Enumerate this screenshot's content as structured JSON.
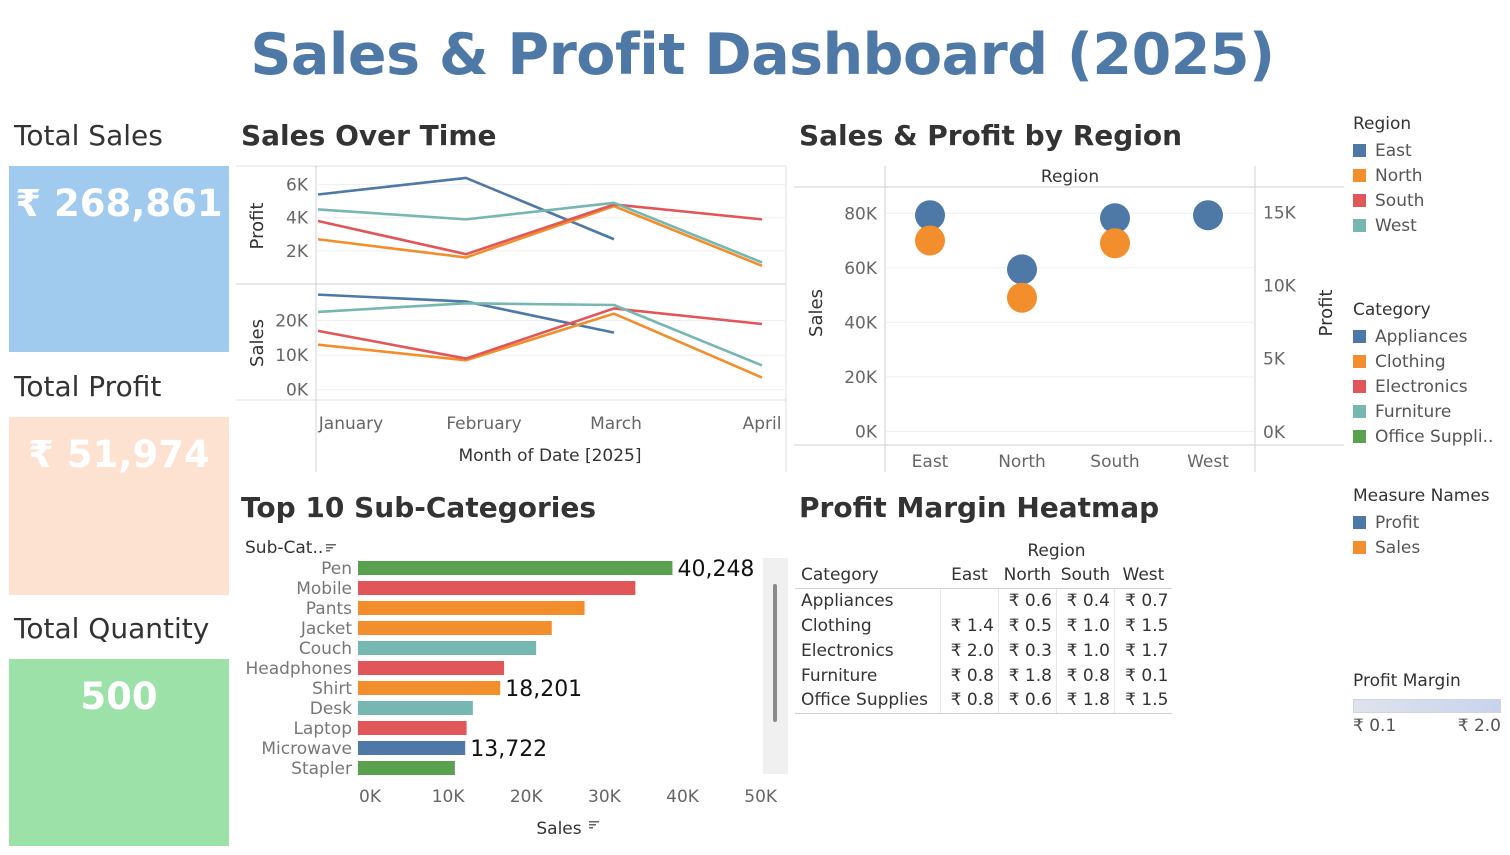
{
  "title": "Sales & Profit Dashboard (2025)",
  "kpis": {
    "total_sales": {
      "label": "Total Sales",
      "value": "₹ 268,861",
      "color": "#a0cbee"
    },
    "total_profit": {
      "label": "Total Profit",
      "value": "₹ 51,974",
      "color": "#fde2d2"
    },
    "total_quantity": {
      "label": "Total Quantity",
      "value": "500",
      "color": "#9ce2a8"
    }
  },
  "sections": {
    "sales_over_time": "Sales Over Time",
    "sales_profit_region": "Sales & Profit by Region",
    "top_subcategories": "Top 10 Sub-Categories",
    "heatmap": "Profit Margin Heatmap"
  },
  "colors": {
    "East": "#4e79a7",
    "North": "#f28e2b",
    "South": "#e15759",
    "West": "#76b7b2",
    "Appliances": "#4e79a7",
    "Clothing": "#f28e2b",
    "Electronics": "#e15759",
    "Furniture": "#76b7b2",
    "Office Supplies": "#59a14f",
    "Profit": "#4e79a7",
    "Sales": "#f28e2b"
  },
  "legends": {
    "region": {
      "title": "Region",
      "items": [
        "East",
        "North",
        "South",
        "West"
      ]
    },
    "category": {
      "title": "Category",
      "items": [
        "Appliances",
        "Clothing",
        "Electronics",
        "Furniture",
        "Office Suppli.."
      ]
    },
    "measure": {
      "title": "Measure Names",
      "items": [
        "Profit",
        "Sales"
      ]
    },
    "profit_margin": {
      "title": "Profit Margin",
      "min_label": "₹ 0.1",
      "max_label": "₹ 2.0",
      "gradient": [
        "#dfe3ec",
        "#c8d3ec"
      ]
    }
  },
  "chart_data": [
    {
      "id": "sales_over_time",
      "type": "line",
      "xlabel": "Month of Date [2025]",
      "categories": [
        "January",
        "February",
        "March",
        "April"
      ],
      "panels": [
        {
          "ylabel": "Profit",
          "yticks": [
            2000,
            4000,
            6000
          ],
          "ytick_labels": [
            "2K",
            "4K",
            "6K"
          ],
          "ylim": [
            0,
            7000
          ],
          "series": [
            {
              "name": "East",
              "values": [
                5400,
                6400,
                2700,
                null
              ]
            },
            {
              "name": "North",
              "values": [
                2700,
                1600,
                4700,
                1100
              ]
            },
            {
              "name": "South",
              "values": [
                3800,
                1800,
                4800,
                3900
              ]
            },
            {
              "name": "West",
              "values": [
                4500,
                3900,
                4900,
                1300
              ]
            }
          ]
        },
        {
          "ylabel": "Sales",
          "yticks": [
            0,
            10000,
            20000
          ],
          "ytick_labels": [
            "0K",
            "10K",
            "20K"
          ],
          "ylim": [
            -3000,
            30000
          ],
          "series": [
            {
              "name": "East",
              "values": [
                27500,
                25500,
                16500,
                null
              ]
            },
            {
              "name": "North",
              "values": [
                13000,
                8500,
                22000,
                3500
              ]
            },
            {
              "name": "South",
              "values": [
                17000,
                9000,
                23500,
                19000
              ]
            },
            {
              "name": "West",
              "values": [
                22500,
                25000,
                24500,
                7000
              ]
            }
          ]
        }
      ]
    },
    {
      "id": "sales_profit_by_region",
      "type": "scatter",
      "header": "Region",
      "categories": [
        "East",
        "North",
        "South",
        "West"
      ],
      "ylabel": "Sales",
      "y2label": "Profit",
      "ylim": [
        -5000,
        90000
      ],
      "yticks": [
        0,
        20000,
        40000,
        60000,
        80000
      ],
      "ytick_labels": [
        "0K",
        "20K",
        "40K",
        "60K",
        "80K"
      ],
      "y2lim": [
        -900,
        16800
      ],
      "y2ticks": [
        0,
        5000,
        10000,
        15000
      ],
      "y2tick_labels": [
        "0K",
        "5K",
        "10K",
        "15K"
      ],
      "series": [
        {
          "name": "Profit",
          "axis": "right",
          "values": [
            14800,
            11100,
            14600,
            14800
          ]
        },
        {
          "name": "Sales",
          "axis": "left",
          "values": [
            70000,
            49000,
            69000,
            null
          ]
        }
      ]
    },
    {
      "id": "top_10_subcategories",
      "type": "bar",
      "orientation": "horizontal",
      "header": "Sub-Cat..",
      "xlabel": "Sales",
      "xlim": [
        -1500,
        52000
      ],
      "xticks": [
        0,
        10000,
        20000,
        30000,
        40000,
        50000
      ],
      "xtick_labels": [
        "0K",
        "10K",
        "20K",
        "30K",
        "40K",
        "50K"
      ],
      "categories": [
        "Pen",
        "Mobile",
        "Pants",
        "Jacket",
        "Couch",
        "Headphones",
        "Shirt",
        "Desk",
        "Laptop",
        "Microwave",
        "Stapler"
      ],
      "values": [
        40248,
        35500,
        29000,
        24800,
        22800,
        18700,
        18201,
        14700,
        13900,
        13722,
        12400
      ],
      "category_group": [
        "Office Supplies",
        "Electronics",
        "Clothing",
        "Clothing",
        "Furniture",
        "Electronics",
        "Clothing",
        "Furniture",
        "Electronics",
        "Appliances",
        "Office Supplies"
      ],
      "data_labels": [
        {
          "index": 0,
          "text": "40,248"
        },
        {
          "index": 6,
          "text": "18,201"
        },
        {
          "index": 9,
          "text": "13,722"
        }
      ]
    },
    {
      "id": "profit_margin_heatmap",
      "type": "table",
      "column_group": "Region",
      "row_header": "Category",
      "columns": [
        "East",
        "North",
        "South",
        "West"
      ],
      "rows": [
        {
          "label": "Appliances",
          "cells": [
            "",
            "₹ 0.6",
            "₹ 0.4",
            "₹ 0.7"
          ]
        },
        {
          "label": "Clothing",
          "cells": [
            "₹ 1.4",
            "₹ 0.5",
            "₹ 1.0",
            "₹ 1.5"
          ]
        },
        {
          "label": "Electronics",
          "cells": [
            "₹ 2.0",
            "₹ 0.3",
            "₹ 1.0",
            "₹ 1.7"
          ]
        },
        {
          "label": "Furniture",
          "cells": [
            "₹ 0.8",
            "₹ 1.8",
            "₹ 0.8",
            "₹ 0.1"
          ]
        },
        {
          "label": "Office Supplies",
          "cells": [
            "₹ 0.8",
            "₹ 0.6",
            "₹ 1.8",
            "₹ 1.5"
          ]
        }
      ]
    }
  ]
}
